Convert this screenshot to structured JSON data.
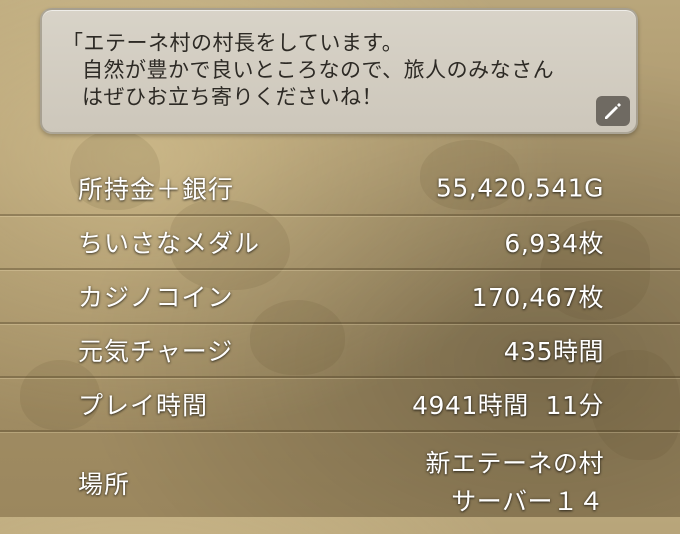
{
  "message": {
    "lines": [
      "「エテーネ村の村長をしています。",
      "自然が豊かで良いところなので、旅人のみなさん",
      "はぜひお立ち寄りくださいね！"
    ],
    "edit_icon": "pencil-icon"
  },
  "stats": [
    {
      "label": "所持金＋銀行",
      "value": "55,420,541G"
    },
    {
      "label": "ちいさなメダル",
      "value": "6,934枚"
    },
    {
      "label": "カジノコイン",
      "value": "170,467枚"
    },
    {
      "label": "元気チャージ",
      "value": "435時間"
    },
    {
      "label": "プレイ時間",
      "value": "4941時間  11分"
    },
    {
      "label": "場所",
      "value_lines": [
        "新エテーネの村",
        "サーバー１４"
      ]
    }
  ],
  "colors": {
    "background": "#a8946a",
    "message_box": "#d3cdc2",
    "text_light": "#ffffff",
    "text_dark": "#2d2a25"
  }
}
